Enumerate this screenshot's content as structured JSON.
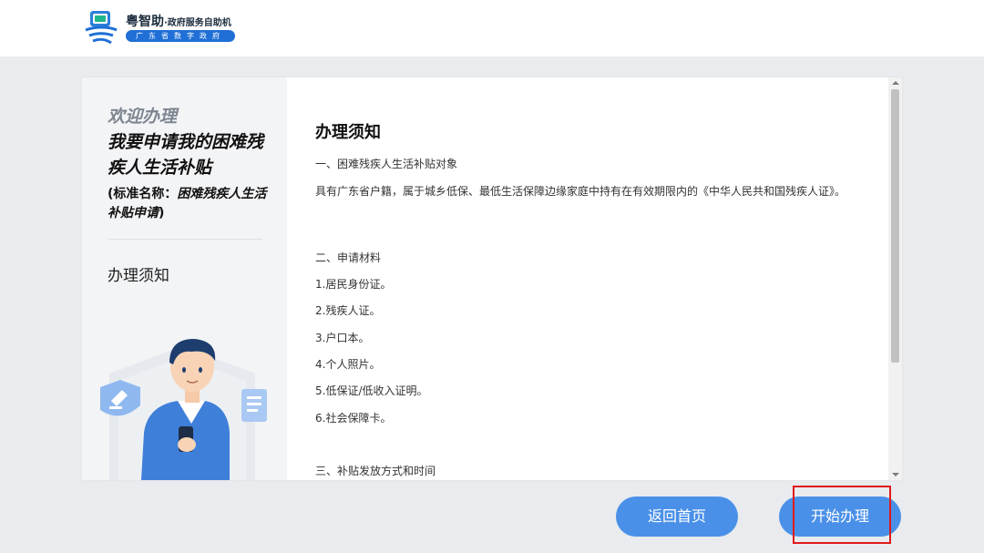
{
  "header": {
    "brand_name": "粤智助",
    "brand_subtitle": "·政府服务自助机",
    "brand_tag": "广东省数字政府",
    "colors": {
      "brand_blue": "#1f6fd6"
    }
  },
  "sidebar": {
    "welcome": "欢迎办理",
    "service_title": "我要申请我的困难残疾人生活补贴",
    "standard_name_prefix": "(标准名称：",
    "standard_name_value": "困难残疾人生活补贴申请",
    "standard_name_suffix": ")",
    "nav_item": "办理须知"
  },
  "content": {
    "title": "办理须知",
    "section1_heading": "一、困难残疾人生活补贴对象",
    "section1_body": "具有广东省户籍，属于城乡低保、最低生活保障边缘家庭中持有在有效期限内的《中华人民共和国残疾人证》。",
    "section2_heading": "二、申请材料",
    "materials": [
      "1.居民身份证。",
      "2.残疾人证。",
      "3.户口本。",
      "4.个人照片。",
      "5.低保证/低收入证明。",
      "6.社会保障卡。"
    ],
    "section3_heading": "三、补贴发放方式和时间"
  },
  "actions": {
    "home_label": "返回首页",
    "start_label": "开始办理",
    "colors": {
      "button_blue": "#4a90e8",
      "highlight_red": "#e0191b"
    }
  }
}
